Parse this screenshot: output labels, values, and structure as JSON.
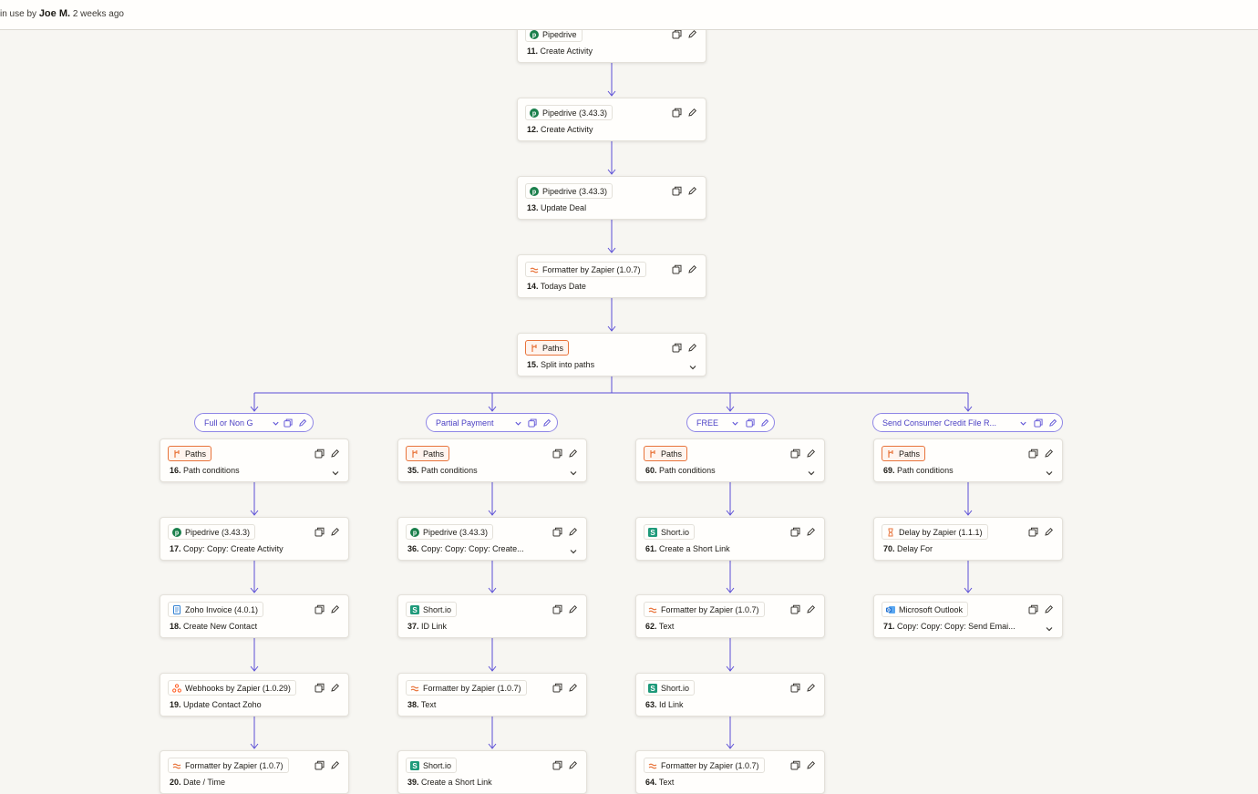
{
  "header": {
    "status_prefix": "in use by",
    "user": "Joe M.",
    "time_ago": "2 weeks ago"
  },
  "colors": {
    "connector": "#5b4fd6",
    "paths_accent": "#e8743b",
    "pipedrive": "#1a7f4b",
    "formatter": "#e8743b",
    "shortio": "#1f9a7a",
    "zoho": "#2f7fd1",
    "webhooks": "#ff5a1f",
    "outlook": "#1f6fd1"
  },
  "main_steps": [
    {
      "app": "Pipedrive",
      "num": "11.",
      "title": "Create Activity",
      "icon": "pipedrive-icon"
    },
    {
      "app": "Pipedrive (3.43.3)",
      "num": "12.",
      "title": "Create Activity",
      "icon": "pipedrive-icon"
    },
    {
      "app": "Pipedrive (3.43.3)",
      "num": "13.",
      "title": "Update Deal",
      "icon": "pipedrive-icon"
    },
    {
      "app": "Formatter by Zapier (1.0.7)",
      "num": "14.",
      "title": "Todays Date",
      "icon": "formatter-icon"
    },
    {
      "app": "Paths",
      "num": "15.",
      "title": "Split into paths",
      "icon": "paths-icon"
    }
  ],
  "branches": [
    {
      "label": "Full or Non G",
      "steps": [
        {
          "app": "Paths",
          "num": "16.",
          "title": "Path conditions",
          "icon": "paths-icon"
        },
        {
          "app": "Pipedrive (3.43.3)",
          "num": "17.",
          "title": "Copy: Copy: Create Activity",
          "icon": "pipedrive-icon"
        },
        {
          "app": "Zoho Invoice (4.0.1)",
          "num": "18.",
          "title": "Create New Contact",
          "icon": "zoho-invoice-icon"
        },
        {
          "app": "Webhooks by Zapier (1.0.29)",
          "num": "19.",
          "title": "Update Contact Zoho",
          "icon": "webhooks-icon"
        },
        {
          "app": "Formatter by Zapier (1.0.7)",
          "num": "20.",
          "title": "Date / Time",
          "icon": "formatter-icon"
        }
      ]
    },
    {
      "label": "Partial Payment",
      "steps": [
        {
          "app": "Paths",
          "num": "35.",
          "title": "Path conditions",
          "icon": "paths-icon"
        },
        {
          "app": "Pipedrive (3.43.3)",
          "num": "36.",
          "title": "Copy: Copy: Copy: Create...",
          "icon": "pipedrive-icon"
        },
        {
          "app": "Short.io",
          "num": "37.",
          "title": "ID Link",
          "icon": "shortio-icon"
        },
        {
          "app": "Formatter by Zapier (1.0.7)",
          "num": "38.",
          "title": "Text",
          "icon": "formatter-icon"
        },
        {
          "app": "Short.io",
          "num": "39.",
          "title": "Create a Short Link",
          "icon": "shortio-icon"
        }
      ]
    },
    {
      "label": "FREE",
      "steps": [
        {
          "app": "Paths",
          "num": "60.",
          "title": "Path conditions",
          "icon": "paths-icon"
        },
        {
          "app": "Short.io",
          "num": "61.",
          "title": "Create a Short Link",
          "icon": "shortio-icon"
        },
        {
          "app": "Formatter by Zapier (1.0.7)",
          "num": "62.",
          "title": "Text",
          "icon": "formatter-icon"
        },
        {
          "app": "Short.io",
          "num": "63.",
          "title": "Id Link",
          "icon": "shortio-icon"
        },
        {
          "app": "Formatter by Zapier (1.0.7)",
          "num": "64.",
          "title": "Text",
          "icon": "formatter-icon"
        }
      ]
    },
    {
      "label": "Send Consumer Credit File R...",
      "steps": [
        {
          "app": "Paths",
          "num": "69.",
          "title": "Path conditions",
          "icon": "paths-icon"
        },
        {
          "app": "Delay by Zapier (1.1.1)",
          "num": "70.",
          "title": "Delay For",
          "icon": "delay-icon"
        },
        {
          "app": "Microsoft Outlook",
          "num": "71.",
          "title": "Copy: Copy: Copy: Send Emai...",
          "icon": "outlook-icon"
        }
      ]
    }
  ]
}
